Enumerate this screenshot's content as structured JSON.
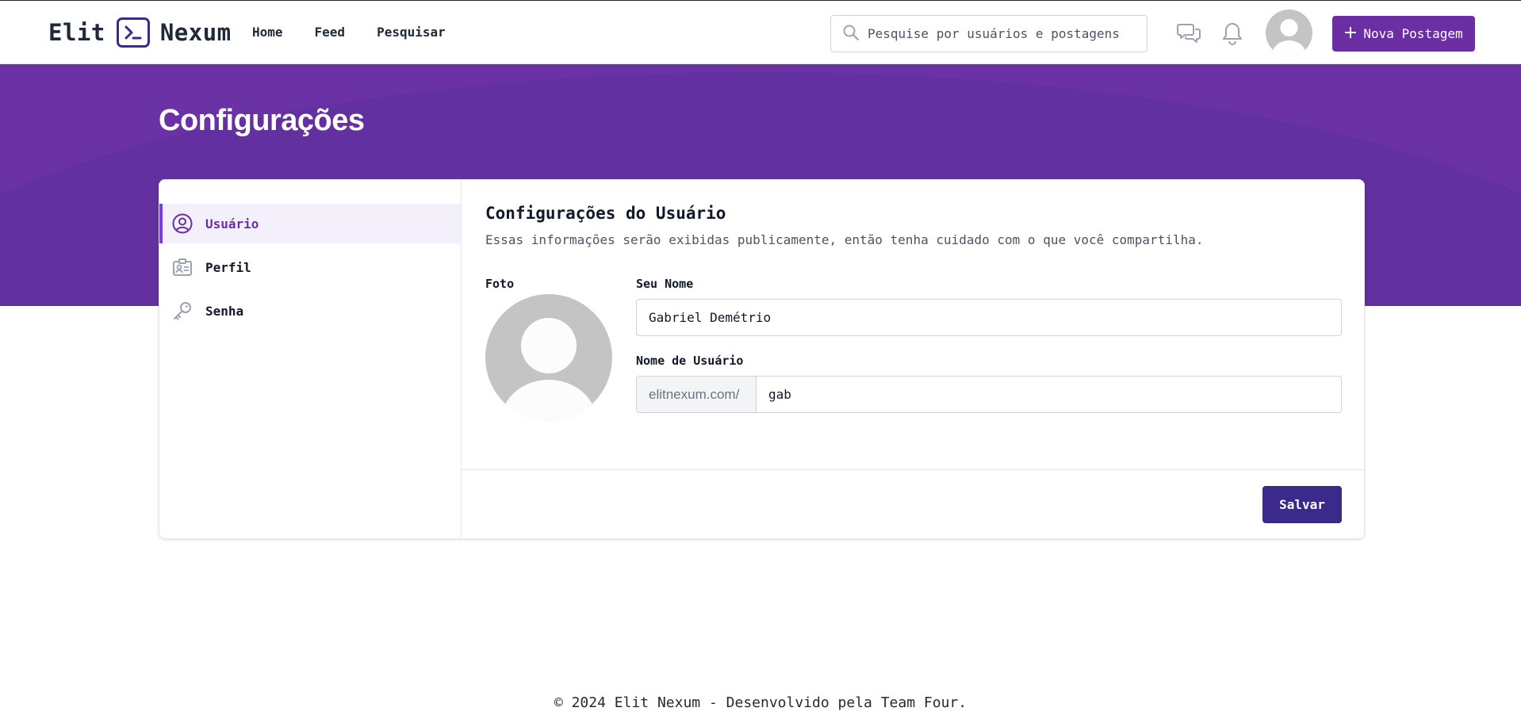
{
  "header": {
    "logo_left": "Elit",
    "logo_right": "Nexum",
    "nav": [
      "Home",
      "Feed",
      "Pesquisar"
    ],
    "search_placeholder": "Pesquise por usuários e postagens",
    "new_post_label": "Nova Postagem"
  },
  "banner": {
    "title": "Configurações"
  },
  "sidebar": {
    "items": [
      {
        "label": "Usuário",
        "icon": "user-circle-icon",
        "active": true
      },
      {
        "label": "Perfil",
        "icon": "id-card-icon",
        "active": false
      },
      {
        "label": "Senha",
        "icon": "key-icon",
        "active": false
      }
    ]
  },
  "settings": {
    "title": "Configurações do Usuário",
    "subtitle": "Essas informações serão exibidas publicamente, então tenha cuidado com o que você compartilha.",
    "photo_label": "Foto",
    "name_label": "Seu Nome",
    "name_value": "Gabriel Demétrio",
    "username_label": "Nome de Usuário",
    "username_prefix": "elitnexum.com/",
    "username_value": "gab",
    "save_label": "Salvar"
  },
  "footer": {
    "text": "© 2024 Elit Nexum - Desenvolvido pela Team Four."
  },
  "colors": {
    "brand_purple": "#6a32a5",
    "button_dark": "#3b2a8a",
    "active_accent": "#7c3aed"
  }
}
